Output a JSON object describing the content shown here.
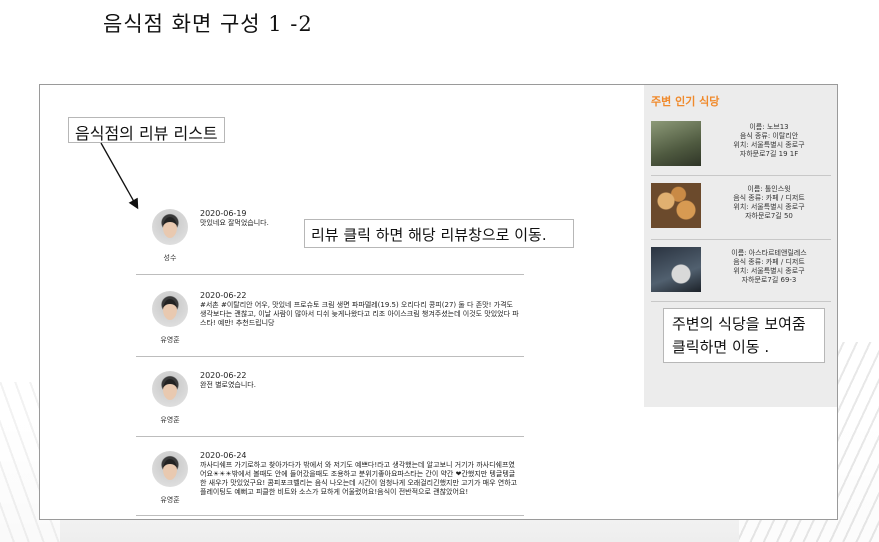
{
  "slide": {
    "title": "음식점 화면 구성 1 -2"
  },
  "callouts": {
    "review_list": "음식점의 리뷰 리스트",
    "review_click": "리뷰 클릭 하면 해당 리뷰창으로 이동.",
    "nearby_line1": "주변의 식당을 보여줌",
    "nearby_line2": "클릭하면 이동 ."
  },
  "reviews": [
    {
      "author": "성수",
      "date": "2020-06-19",
      "text": "맛있네요 잘먹었습니다."
    },
    {
      "author": "유영훈",
      "date": "2020-06-22",
      "text": "#서촌 #이탈리안 어우, 맛있네 프로슈토 크림 생면 파파델레(19.5) 오리다리 콩피(27) 둘 다 존맛! 가격도 생각보다는 괜찮고, 이날 사람이 많아서 디쉬 늦게나왔다고 리조 아이스크림 챙겨주셨는데 이것도 맛있었다 파스타! 예만! 추천드립니당"
    },
    {
      "author": "유영훈",
      "date": "2020-06-22",
      "text": "완전 별로였습니다."
    },
    {
      "author": "유영훈",
      "date": "2020-06-24",
      "text": "까사디쉐프 가기로하고 찾아가다가 밖에서 와 저기도 예쁘다!라고 생각했는데 알고보니 거기가 까사디쉐프였어요☀☀☀밖에서 볼때도 안에 들어갔을때도 조용하고 분위기좋아요파스타는 간이 약간 ❤간했지만 텡글텡글한 새우가 맛있었구요! 콤피포크벨리는 음식 나오는데 시간이 엄청나게 오래걸리긴했지만 고기가 매우 연하고 플레이팅도 예뻐고 피클한 비트와 소스가 묘하게 어울렸어요!음식이 전반적으로 괜찮았어요!"
    }
  ],
  "sidebar": {
    "title": "주변 인기 식당",
    "places": [
      {
        "name": "이름: 노브13",
        "type": "음식 종류: 이탈리안",
        "loc1": "위치: 서울특별시 종로구",
        "loc2": "자하문로7길 19 1F",
        "thumb": "#6c7a5a"
      },
      {
        "name": "이름: 톨인스윗",
        "type": "음식 종류: 카페 / 디저트",
        "loc1": "위치: 서울특별시 종로구",
        "loc2": "자하문로7길 50",
        "thumb": "#b5844a"
      },
      {
        "name": "이름: 아스타르테앤릴레스",
        "type": "음식 종류: 카페 / 디저트",
        "loc1": "위치: 서울특별시 종로구",
        "loc2": "자하문로7길 69-3",
        "thumb": "#3d4a5a"
      }
    ]
  },
  "colors": {
    "sidebar_title": "#f08a2c",
    "sidebar_bg": "#ececec"
  }
}
